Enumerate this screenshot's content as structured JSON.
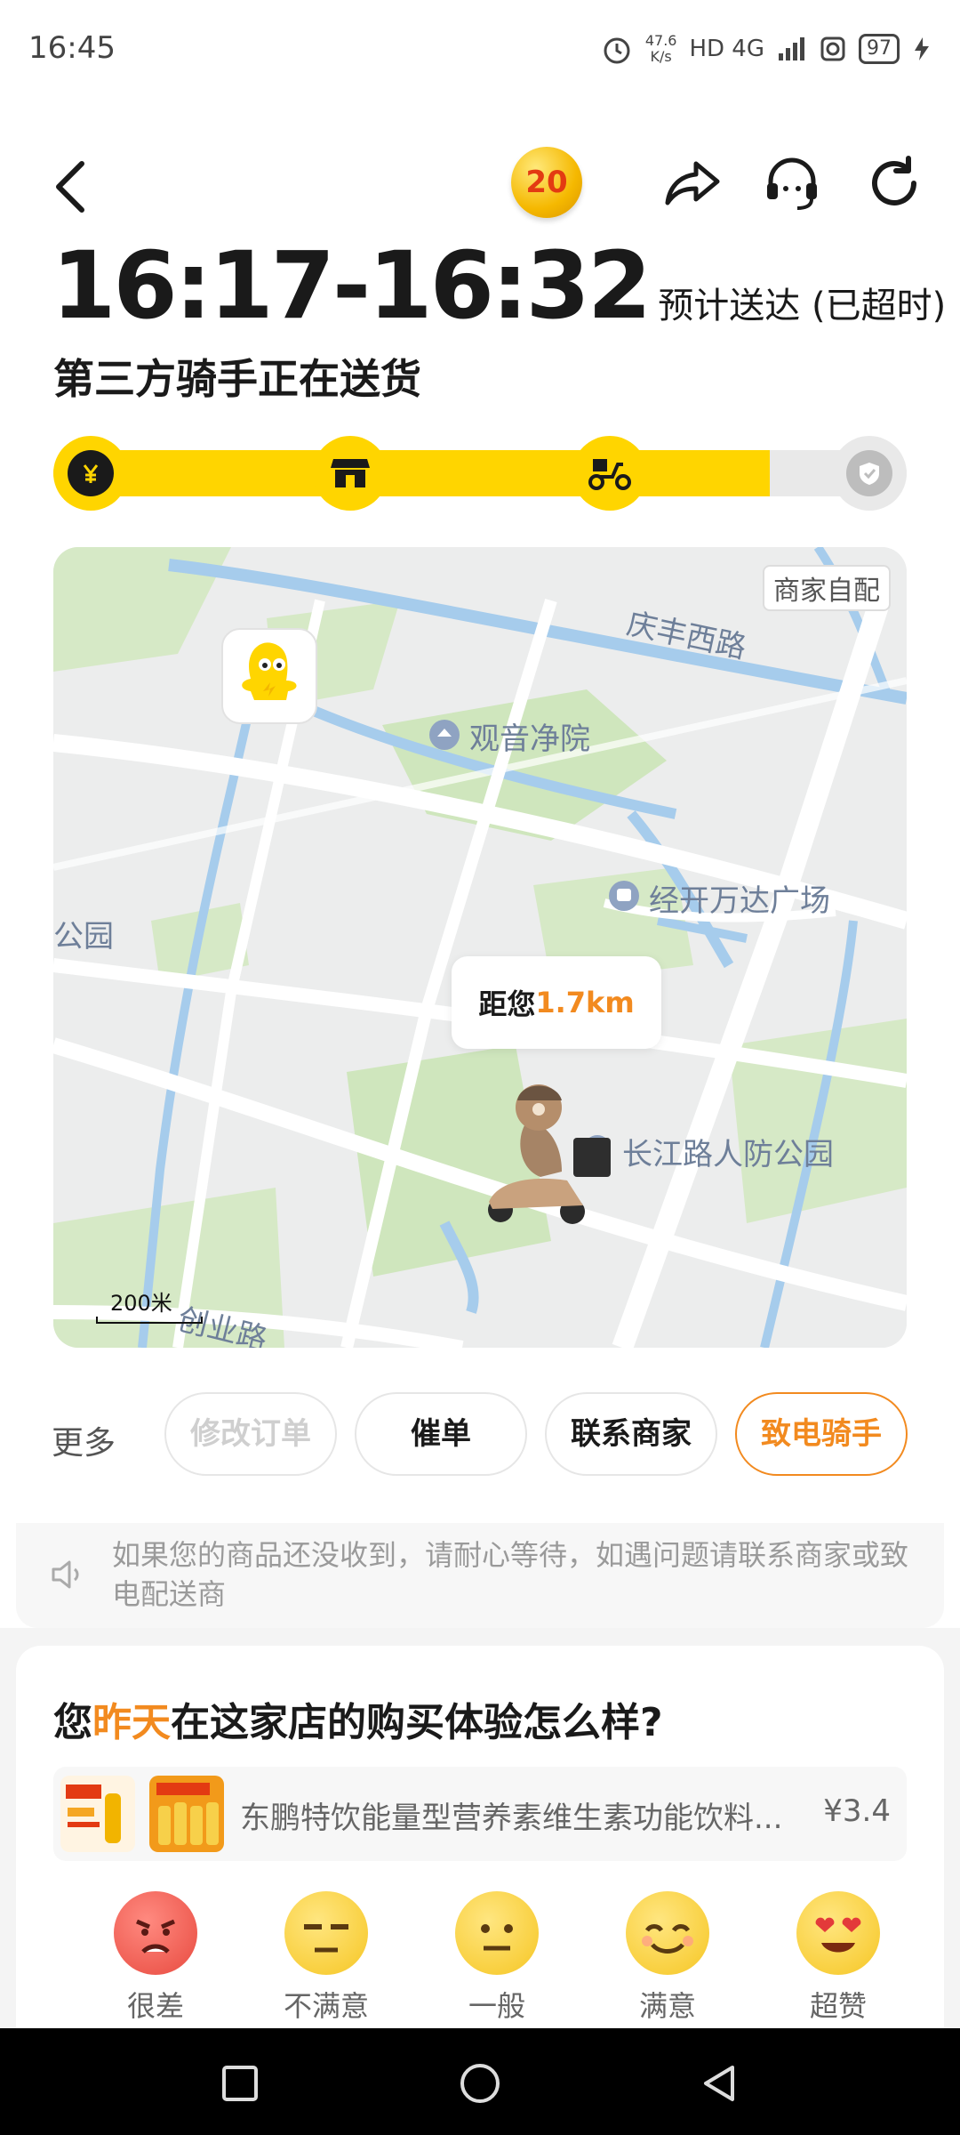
{
  "status_bar": {
    "time": "16:45",
    "speed_value": "47.6",
    "speed_unit": "K/s",
    "network": "HD 4G",
    "battery": "97"
  },
  "header": {
    "coin_badge": "20",
    "icons": [
      "back-icon",
      "share-icon",
      "customer-service-icon",
      "refresh-icon"
    ]
  },
  "delivery": {
    "eta_range": "16:17-16:32",
    "eta_note": "预计送达 (已超时)",
    "status": "第三方骑手正在送货",
    "progress_fraction": 0.84,
    "steps": [
      "paid-icon",
      "store-icon",
      "rider-icon",
      "check-icon"
    ]
  },
  "map": {
    "self_delivery_tag": "商家自配",
    "labels": {
      "road1": "庆丰西路",
      "poi1": "观音净院",
      "poi2": "经开万达广场",
      "poi3": "公园",
      "poi4": "长江路人防公园",
      "road2": "创业路"
    },
    "distance_prefix": "距您",
    "distance_value": "1.7km",
    "scale": "200米"
  },
  "actions": {
    "more_label": "更多",
    "buttons": [
      "修改订单",
      "催单",
      "联系商家",
      "致电骑手"
    ]
  },
  "notice": {
    "text": "如果您的商品还没收到，请耐心等待，如遇问题请联系商家或致电配送商"
  },
  "review": {
    "question_pre": "您",
    "question_highlight": "昨天",
    "question_post": "在这家店的购买体验怎么样?",
    "product_name": "东鹏特饮能量型营养素维生素功能饮料...",
    "product_price": "¥3.4",
    "ratings": [
      "很差",
      "不满意",
      "一般",
      "满意",
      "超赞"
    ]
  },
  "colors": {
    "accent_yellow": "#ffd500",
    "accent_orange": "#f28a1f"
  }
}
